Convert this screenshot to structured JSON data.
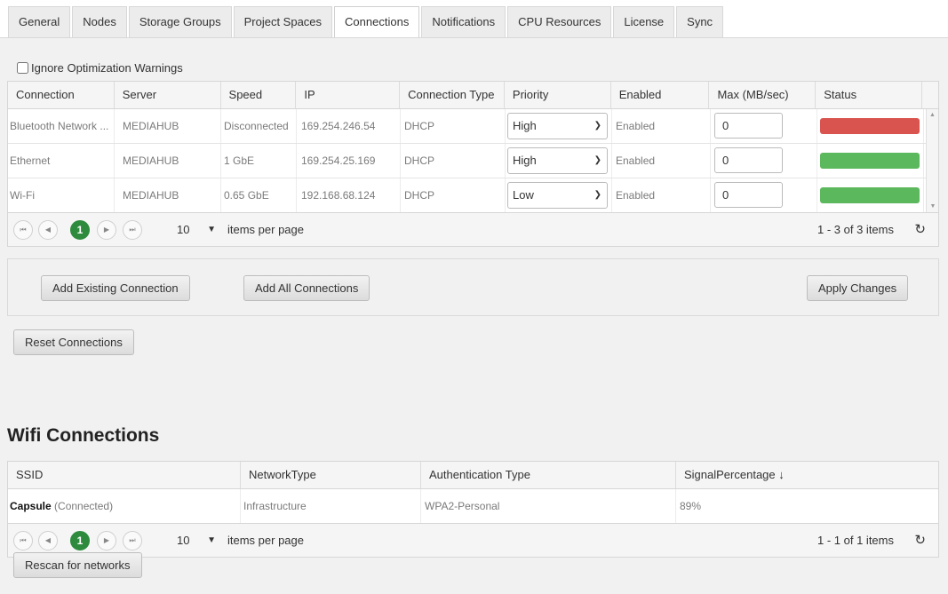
{
  "tabs": [
    {
      "label": "General",
      "active": false
    },
    {
      "label": "Nodes",
      "active": false
    },
    {
      "label": "Storage Groups",
      "active": false
    },
    {
      "label": "Project Spaces",
      "active": false
    },
    {
      "label": "Connections",
      "active": true
    },
    {
      "label": "Notifications",
      "active": false
    },
    {
      "label": "CPU Resources",
      "active": false
    },
    {
      "label": "License",
      "active": false
    },
    {
      "label": "Sync",
      "active": false
    }
  ],
  "ignore_warnings": {
    "label": "Ignore Optimization Warnings",
    "checked": false
  },
  "connections": {
    "columns": [
      "Connection",
      "Server",
      "Speed",
      "IP",
      "Connection Type",
      "Priority",
      "Enabled",
      "Max (MB/sec)",
      "Status"
    ],
    "rows": [
      {
        "connection": "Bluetooth Network ...",
        "server": "MEDIAHUB",
        "speed": "Disconnected",
        "ip": "169.254.246.54",
        "type": "DHCP",
        "priority": "High",
        "enabled": "Enabled",
        "max": "0",
        "status_color": "#d9534f"
      },
      {
        "connection": "Ethernet",
        "server": "MEDIAHUB",
        "speed": "1 GbE",
        "ip": "169.254.25.169",
        "type": "DHCP",
        "priority": "High",
        "enabled": "Enabled",
        "max": "0",
        "status_color": "#5cb85c"
      },
      {
        "connection": "Wi-Fi",
        "server": "MEDIAHUB",
        "speed": "0.65 GbE",
        "ip": "192.168.68.124",
        "type": "DHCP",
        "priority": "Low",
        "enabled": "Enabled",
        "max": "0",
        "status_color": "#5cb85c"
      }
    ],
    "pager": {
      "current_page": "1",
      "page_size": "10",
      "items_label": "items per page",
      "info": "1 - 3 of 3 items"
    }
  },
  "buttons": {
    "add_existing": "Add Existing Connection",
    "add_all": "Add All Connections",
    "apply": "Apply Changes",
    "reset": "Reset Connections",
    "rescan": "Rescan for networks"
  },
  "wifi": {
    "title": "Wifi Connections",
    "columns": [
      "SSID",
      "NetworkType",
      "Authentication Type",
      "SignalPercentage ↓"
    ],
    "rows": [
      {
        "ssid": "Capsule",
        "ssid_note": "(Connected)",
        "network_type": "Infrastructure",
        "auth": "WPA2-Personal",
        "signal": "89%"
      }
    ],
    "pager": {
      "current_page": "1",
      "page_size": "10",
      "items_label": "items per page",
      "info": "1 - 1 of 1 items"
    }
  },
  "icons": {
    "first": "first-page-icon",
    "prev": "prev-page-icon",
    "next": "next-page-icon",
    "last": "last-page-icon",
    "refresh": "refresh-icon"
  },
  "colors": {
    "status_red": "#d9534f",
    "status_green": "#5cb85c",
    "pager_active": "#2e8b3e",
    "enabled_text": "#e05a5a"
  }
}
